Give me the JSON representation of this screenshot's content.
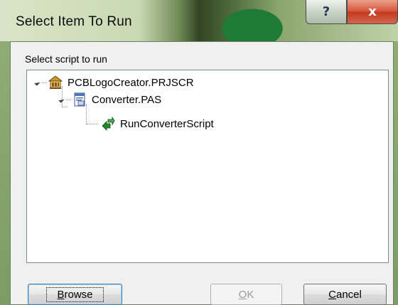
{
  "window": {
    "title": "Select Item To Run",
    "help_label": "?",
    "close_label": "x"
  },
  "prompt": "Select script to run",
  "tree": {
    "project": {
      "label": "PCBLogoCreator.PRJSCR",
      "icon": "project-icon",
      "expanded": true
    },
    "unit": {
      "label": "Converter.PAS",
      "icon": "script-file-icon",
      "expanded": true
    },
    "procedure": {
      "label": "RunConverterScript",
      "icon": "run-procedure-icon"
    }
  },
  "buttons": {
    "browse_mnemonic": "B",
    "browse_rest": "rowse",
    "ok_mnemonic": "O",
    "ok_rest": "K",
    "cancel_mnemonic": "C",
    "cancel_rest": "ancel"
  }
}
